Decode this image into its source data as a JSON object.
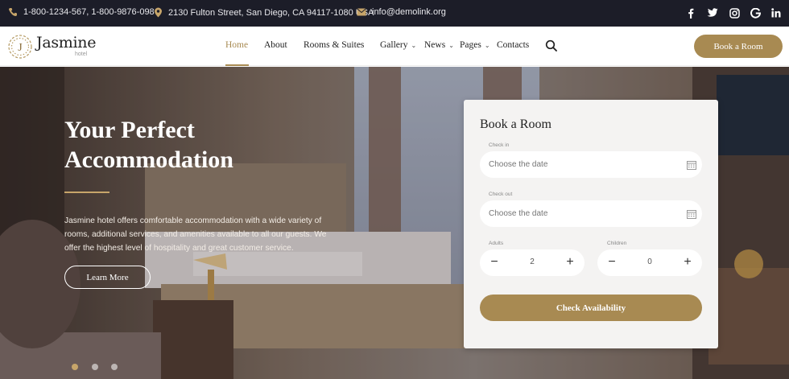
{
  "topbar": {
    "phones": "1-800-1234-567, 1-800-9876-098",
    "address": "2130 Fulton Street, San Diego, CA 94117-1080 USA",
    "email": "info@demolink.org",
    "social": [
      "facebook-icon",
      "twitter-icon",
      "instagram-icon",
      "google-icon",
      "linkedin-icon"
    ]
  },
  "brand": {
    "name": "Jasmine",
    "sub": "hotel",
    "accent_color": "#a88a52"
  },
  "nav": {
    "items": [
      {
        "label": "Home",
        "active": true
      },
      {
        "label": "About"
      },
      {
        "label": "Rooms & Suites"
      },
      {
        "label": "Gallery",
        "dropdown": true
      },
      {
        "label": "News",
        "dropdown": true
      },
      {
        "label": "Pages",
        "dropdown": true
      },
      {
        "label": "Contacts"
      }
    ],
    "cta_label": "Book a Room"
  },
  "hero": {
    "title": "Your Perfect Accommodation",
    "description": "Jasmine hotel offers comfortable accommodation with a wide variety of rooms, additional services, and amenities available to all our guests. We offer the highest level of hospitality and great customer service.",
    "cta_label": "Learn More",
    "slides_count": 3,
    "active_slide": 1
  },
  "booking": {
    "title": "Book a Room",
    "checkin_label": "Check in",
    "checkin_placeholder": "Choose the date",
    "checkout_label": "Check out",
    "checkout_placeholder": "Choose the date",
    "adults_label": "Adults",
    "adults_value": "2",
    "children_label": "Children",
    "children_value": "0",
    "submit_label": "Check Availability"
  }
}
